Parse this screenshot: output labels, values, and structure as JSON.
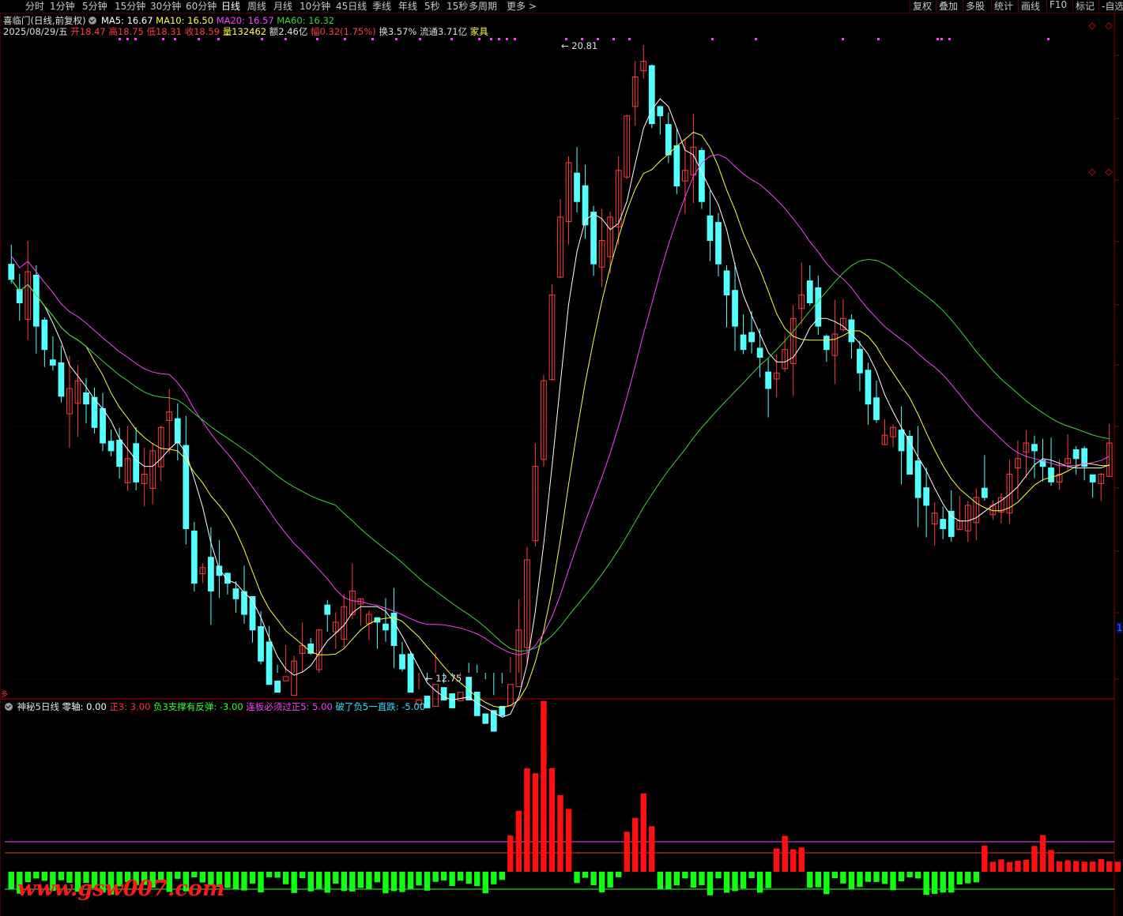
{
  "toolbar": {
    "periods": [
      "分时",
      "1分钟",
      "5分钟",
      "15分钟",
      "30分钟",
      "60分钟",
      "日线",
      "周线",
      "月线",
      "10分钟",
      "45日线",
      "季线",
      "年线",
      "5秒",
      "15秒",
      "多周期",
      "更多 >"
    ],
    "active_period": "日线",
    "tools": [
      "复权",
      "叠加",
      "多股",
      "统计",
      "画线",
      "F10",
      "标记",
      "-自选"
    ]
  },
  "header": {
    "stock_name": "喜临门(日线,前复权)",
    "ma": [
      {
        "label": "MA5: 16.67",
        "color": "#ffffff"
      },
      {
        "label": "MA10: 16.50",
        "color": "#ffff40"
      },
      {
        "label": "MA20: 16.57",
        "color": "#ff40ff"
      },
      {
        "label": "MA60: 16.32",
        "color": "#40d040"
      }
    ],
    "date": "2025/08/29/五",
    "open_label": "开",
    "open": "18.47",
    "high_label": "高",
    "high": "18.75",
    "low_label": "低",
    "low": "18.31",
    "close_label": "收",
    "close": "18.59",
    "vol_label": "量",
    "vol": "132462",
    "amount_label": "额",
    "amount": "2.46亿",
    "change_label": "幅",
    "change": "0.32(1.75%)",
    "turnover_label": "换",
    "turnover": "3.57%",
    "float_label": "流通",
    "float_cap": "3.71亿",
    "sector": "家具"
  },
  "annotations": {
    "high": "20.81",
    "low": "12.75"
  },
  "indicator": {
    "name": "神秘5日线",
    "items": [
      {
        "label": "零轴: 0.00",
        "color": "#ffffff"
      },
      {
        "label": "正3: 3.00",
        "color": "#ff3030"
      },
      {
        "label": "负3支撑有反弹: -3.00",
        "color": "#30ff30"
      },
      {
        "label": "连板必须过正5: 5.00",
        "color": "#ff40ff"
      },
      {
        "label": "破了负5一直跌: -5.00",
        "color": "#40e0ff"
      }
    ]
  },
  "side_marker": "1",
  "corner_marker": "多",
  "watermark": "www.gsw007.com",
  "colors": {
    "up": "#ff3c3c",
    "down": "#54ffff",
    "ma5": "#ffffff",
    "ma10": "#ffff40",
    "ma20": "#ff40ff",
    "ma60": "#40d040",
    "grid": "#7a0000",
    "pos_bar": "#ff1010",
    "neg_bar": "#10ff10"
  },
  "chart_data": {
    "type": "candlestick",
    "price_range": [
      12.75,
      20.81
    ],
    "close_series": [
      17.8,
      17.5,
      17.9,
      17.2,
      16.9,
      16.7,
      16.3,
      16.4,
      16.5,
      16.2,
      15.9,
      15.7,
      15.6,
      15.4,
      15.5,
      15.2,
      15.3,
      15.6,
      15.9,
      16.1,
      15.7,
      14.6,
      13.9,
      14.1,
      13.8,
      14.0,
      13.9,
      13.7,
      13.5,
      13.3,
      12.9,
      12.6,
      12.5,
      12.7,
      12.9,
      13.1,
      13.0,
      13.3,
      13.5,
      13.4,
      13.6,
      13.8,
      13.7,
      13.5,
      13.4,
      13.3,
      13.1,
      12.8,
      12.5,
      12.4,
      12.3,
      12.6,
      12.4,
      12.3,
      12.5,
      12.4,
      12.2,
      12.1,
      12.0,
      12.2,
      12.6,
      13.3,
      14.2,
      15.4,
      16.5,
      17.6,
      18.6,
      19.3,
      18.8,
      18.5,
      18.0,
      18.3,
      18.6,
      19.2,
      19.9,
      20.4,
      20.6,
      19.8,
      19.9,
      19.4,
      19.0,
      19.2,
      19.5,
      18.8,
      18.3,
      18.0,
      17.6,
      17.2,
      16.9,
      17.0,
      16.8,
      16.4,
      16.6,
      16.9,
      17.3,
      17.6,
      17.5,
      17.2,
      16.9,
      17.1,
      17.3,
      17.0,
      16.6,
      16.2,
      16.0,
      15.8,
      15.9,
      15.6,
      15.3,
      15.0,
      14.9,
      14.8,
      14.6,
      14.5,
      14.7,
      14.9,
      15.0,
      15.0,
      14.9,
      15.0,
      15.3,
      15.5,
      15.7,
      15.6,
      15.4,
      15.2,
      15.3,
      15.5,
      15.5,
      15.4,
      15.2,
      15.3,
      15.7
    ],
    "indicator_values": [
      -1,
      -1,
      -1,
      -1,
      -1,
      -1,
      -1,
      -1,
      -1,
      -1,
      -1,
      -1,
      -1,
      -1,
      -1,
      -1,
      -1,
      -1,
      -1,
      -1,
      -1,
      -1,
      -1,
      -1,
      -1,
      -1,
      -1,
      -1,
      -1,
      -1,
      -1,
      -1,
      -1,
      -1,
      -1,
      -1,
      -1,
      -1,
      -1,
      -1,
      -1,
      -1,
      -1,
      -1,
      -1,
      -1,
      -1,
      -1,
      -1,
      -1,
      -1,
      -1,
      -1,
      -1,
      -1,
      -1,
      -1,
      -1,
      -1,
      -1,
      3,
      5,
      8,
      10,
      14,
      10,
      7,
      5,
      -1,
      -1,
      -1,
      -1,
      -1,
      -1,
      4,
      5,
      6,
      4,
      -1,
      -1,
      -1,
      -1,
      -1,
      -1,
      -1,
      -1,
      -1,
      -1,
      -1,
      -1,
      -1,
      -1,
      2,
      3,
      2,
      2,
      -1,
      -1,
      -1,
      -1,
      -1,
      -1,
      -1,
      -1,
      -1,
      -1,
      -1,
      -1,
      -1,
      -1,
      -1,
      -1,
      -1,
      -1,
      -1,
      -1,
      -1,
      2,
      1,
      1,
      1,
      1,
      1,
      2,
      3,
      2,
      1,
      1,
      1,
      1,
      1,
      1,
      1,
      1,
      1,
      1,
      4
    ]
  }
}
